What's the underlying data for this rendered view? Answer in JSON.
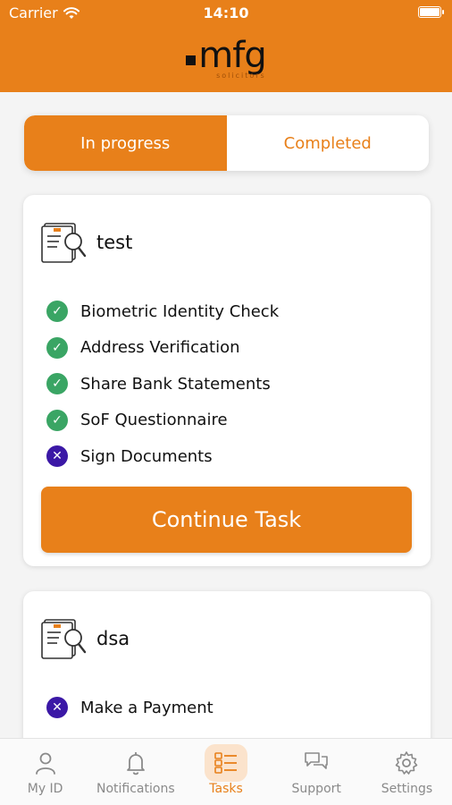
{
  "status_bar": {
    "carrier": "Carrier",
    "time": "14:10"
  },
  "header": {
    "logo_text": "mfg",
    "logo_subtext": "solicitors"
  },
  "segmented": {
    "tabs": [
      {
        "label": "In progress",
        "active": true
      },
      {
        "label": "Completed",
        "active": false
      }
    ]
  },
  "tasks": [
    {
      "title": "test",
      "icon": "document-search-icon",
      "steps": [
        {
          "label": "Biometric Identity Check",
          "status": "done"
        },
        {
          "label": "Address Verification",
          "status": "done"
        },
        {
          "label": "Share Bank Statements",
          "status": "done"
        },
        {
          "label": "SoF Questionnaire",
          "status": "done"
        },
        {
          "label": "Sign Documents",
          "status": "pending"
        }
      ],
      "action_label": "Continue Task"
    },
    {
      "title": "dsa",
      "icon": "document-search-icon",
      "steps": [
        {
          "label": "Make a Payment",
          "status": "pending"
        }
      ]
    }
  ],
  "tabbar": {
    "items": [
      {
        "label": "My ID",
        "icon": "person-icon"
      },
      {
        "label": "Notifications",
        "icon": "bell-icon"
      },
      {
        "label": "Tasks",
        "icon": "tasks-icon",
        "active": true
      },
      {
        "label": "Support",
        "icon": "chat-bubbles-icon"
      },
      {
        "label": "Settings",
        "icon": "gear-icon"
      }
    ]
  },
  "colors": {
    "brand": "#e8801a",
    "done": "#3aa564",
    "pending": "#3b18a6",
    "tab_inactive": "#8a8a8a"
  }
}
